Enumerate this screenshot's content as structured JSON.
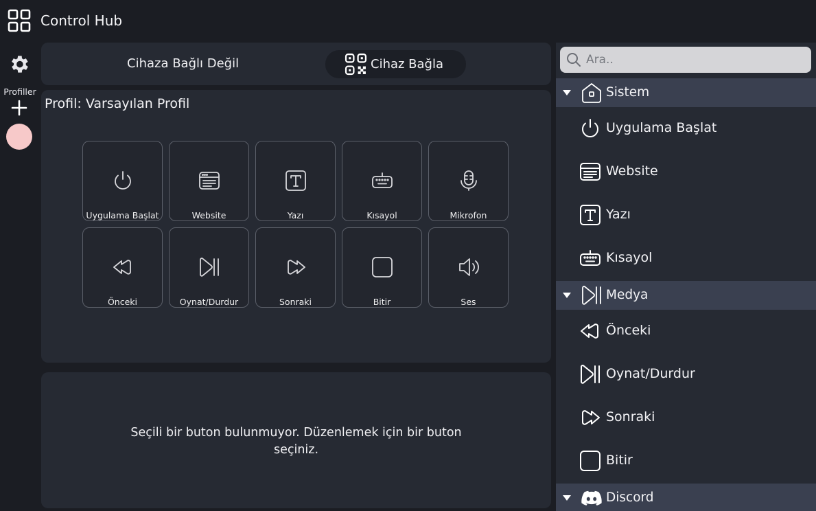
{
  "app": {
    "title": "Control Hub"
  },
  "nav": {
    "profiles_label": "Profiller",
    "profile_color": "#f7c9c9"
  },
  "connection": {
    "status": "Cihaza Bağlı Değil",
    "connect_label": "Cihaz Bağla"
  },
  "profile": {
    "title": "Profil: Varsayılan Profil"
  },
  "tiles": [
    {
      "label": "Uygulama Başlat",
      "icon": "power-icon"
    },
    {
      "label": "Website",
      "icon": "browser-icon"
    },
    {
      "label": "Yazı",
      "icon": "text-icon"
    },
    {
      "label": "Kısayol",
      "icon": "keyboard-icon"
    },
    {
      "label": "Mikrofon",
      "icon": "microphone-icon"
    },
    {
      "label": "Önceki",
      "icon": "previous-icon"
    },
    {
      "label": "Oynat/Durdur",
      "icon": "play-pause-icon"
    },
    {
      "label": "Sonraki",
      "icon": "next-icon"
    },
    {
      "label": "Bitir",
      "icon": "stop-icon"
    },
    {
      "label": "Ses",
      "icon": "volume-icon"
    }
  ],
  "editor": {
    "empty_message": "Seçili bir buton bulunmuyor. Düzenlemek için bir buton seçiniz."
  },
  "sidebar": {
    "search_placeholder": "Ara..",
    "categories": [
      {
        "label": "Sistem",
        "icon": "home-icon"
      },
      {
        "label": "Medya",
        "icon": "play-pause-icon"
      },
      {
        "label": "Discord",
        "icon": "discord-icon"
      }
    ],
    "items": [
      {
        "label": "Uygulama Başlat",
        "icon": "power-icon"
      },
      {
        "label": "Website",
        "icon": "browser-icon"
      },
      {
        "label": "Yazı",
        "icon": "text-icon"
      },
      {
        "label": "Kısayol",
        "icon": "keyboard-icon"
      },
      {
        "label": "Önceki",
        "icon": "previous-icon"
      },
      {
        "label": "Oynat/Durdur",
        "icon": "play-pause-icon"
      },
      {
        "label": "Sonraki",
        "icon": "next-icon"
      },
      {
        "label": "Bitir",
        "icon": "stop-icon"
      }
    ]
  }
}
